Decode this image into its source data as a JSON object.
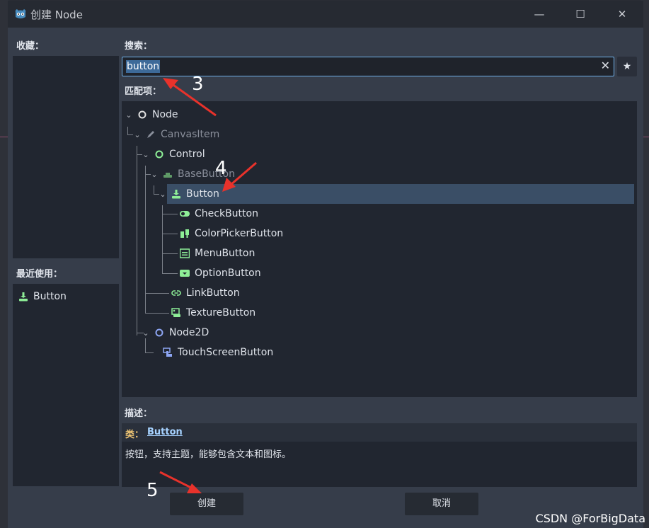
{
  "window": {
    "title": "创建 Node",
    "controls": {
      "minimize": "—",
      "maximize": "☐",
      "close": "✕"
    }
  },
  "favorites": {
    "label": "收藏："
  },
  "recent": {
    "label": "最近使用：",
    "items": [
      {
        "label": "Button",
        "icon": "button-icon"
      }
    ]
  },
  "search": {
    "label": "搜索：",
    "value": "button",
    "clear_icon": "✕",
    "favorite_icon": "★"
  },
  "matches": {
    "label": "匹配项：",
    "tree": [
      {
        "label": "Node",
        "icon": "node-icon",
        "dim": false,
        "selected": false
      },
      {
        "label": "CanvasItem",
        "icon": "canvasitem-icon",
        "dim": true,
        "selected": false
      },
      {
        "label": "Control",
        "icon": "control-icon",
        "dim": false,
        "selected": false
      },
      {
        "label": "BaseButton",
        "icon": "basebutton-icon",
        "dim": true,
        "selected": false
      },
      {
        "label": "Button",
        "icon": "button-icon",
        "dim": false,
        "selected": true
      },
      {
        "label": "CheckButton",
        "icon": "checkbutton-icon",
        "dim": false,
        "selected": false
      },
      {
        "label": "ColorPickerButton",
        "icon": "colorpickerbutton-icon",
        "dim": false,
        "selected": false
      },
      {
        "label": "MenuButton",
        "icon": "menubutton-icon",
        "dim": false,
        "selected": false
      },
      {
        "label": "OptionButton",
        "icon": "optionbutton-icon",
        "dim": false,
        "selected": false
      },
      {
        "label": "LinkButton",
        "icon": "linkbutton-icon",
        "dim": false,
        "selected": false
      },
      {
        "label": "TextureButton",
        "icon": "texturebutton-icon",
        "dim": false,
        "selected": false
      },
      {
        "label": "Node2D",
        "icon": "node2d-icon",
        "dim": false,
        "selected": false
      },
      {
        "label": "TouchScreenButton",
        "icon": "touchscreenbutton-icon",
        "dim": false,
        "selected": false
      }
    ]
  },
  "description": {
    "label": "描述：",
    "class_key": "类：",
    "class_name": "Button",
    "text": "按钮，支持主题，能够包含文本和图标。"
  },
  "buttons": {
    "create": "创建",
    "cancel": "取消"
  },
  "annotations": {
    "step3": "3",
    "step4": "4",
    "step5": "5"
  },
  "watermark": "CSDN @ForBigData",
  "colors": {
    "control_green": "#8eef97",
    "node_white": "#e0e0e0",
    "node2d_blue": "#8da5f3",
    "selection": "#3a4e66",
    "search_border": "#6fb0e8",
    "arrow_red": "#e8322b"
  }
}
